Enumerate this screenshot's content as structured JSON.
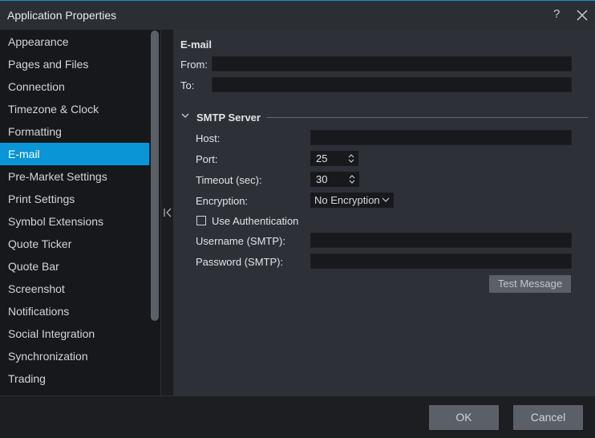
{
  "window": {
    "title": "Application Properties",
    "help_label": "?"
  },
  "sidebar": {
    "items": [
      {
        "label": "Appearance"
      },
      {
        "label": "Pages and Files"
      },
      {
        "label": "Connection"
      },
      {
        "label": "Timezone & Clock"
      },
      {
        "label": "Formatting"
      },
      {
        "label": "E-mail",
        "active": true
      },
      {
        "label": "Pre-Market Settings"
      },
      {
        "label": "Print Settings"
      },
      {
        "label": "Symbol Extensions"
      },
      {
        "label": "Quote Ticker"
      },
      {
        "label": "Quote Bar"
      },
      {
        "label": "Screenshot"
      },
      {
        "label": "Notifications"
      },
      {
        "label": "Social Integration"
      },
      {
        "label": "Synchronization"
      },
      {
        "label": "Trading"
      }
    ]
  },
  "email": {
    "heading": "E-mail",
    "from_label": "From:",
    "from_value": "",
    "to_label": "To:",
    "to_value": ""
  },
  "smtp": {
    "section_label": "SMTP Server",
    "host_label": "Host:",
    "host_value": "",
    "port_label": "Port:",
    "port_value": "25",
    "timeout_label": "Timeout (sec):",
    "timeout_value": "30",
    "encryption_label": "Encryption:",
    "encryption_value": "No Encryption",
    "use_auth_label": "Use Authentication",
    "use_auth_checked": false,
    "username_label": "Username (SMTP):",
    "username_value": "",
    "password_label": "Password (SMTP):",
    "password_value": "",
    "test_button_label": "Test Message"
  },
  "footer": {
    "ok_label": "OK",
    "cancel_label": "Cancel"
  },
  "colors": {
    "accent": "#0a95d7",
    "panel": "#2d3036",
    "sidebar": "#16181b",
    "field": "#17191c"
  }
}
